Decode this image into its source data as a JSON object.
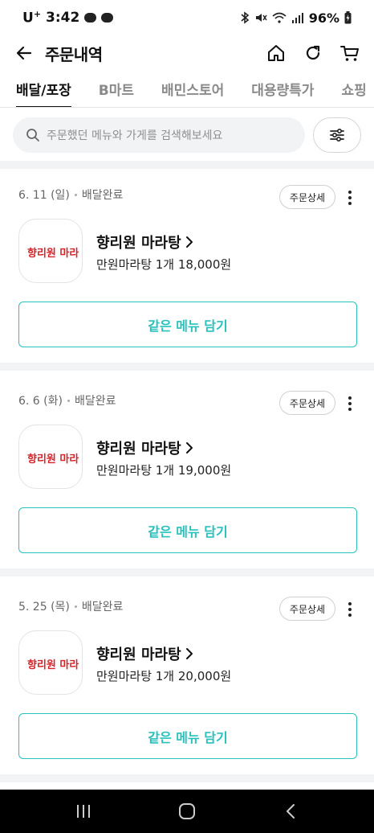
{
  "status_bar": {
    "carrier": "U",
    "carrier_sup": "+",
    "time": "3:42",
    "battery": "96%"
  },
  "header": {
    "title": "주문내역"
  },
  "tabs": [
    {
      "label": "배달/포장",
      "active": true
    },
    {
      "label": "B마트",
      "active": false
    },
    {
      "label": "배민스토어",
      "active": false
    },
    {
      "label": "대용량특가",
      "active": false
    },
    {
      "label": "쇼핑",
      "active": false
    }
  ],
  "search": {
    "placeholder": "주문했던 메뉴와 가게를 검색해보세요"
  },
  "orders": [
    {
      "date": "6. 11 (일)",
      "status": "배달완료",
      "detail_label": "주문상세",
      "store": "향리원 마라탕",
      "summary": "만원마라탕 1개 18,000원",
      "reorder_label": "같은 메뉴 담기",
      "logo_text": "향리원 마라탕"
    },
    {
      "date": "6. 6 (화)",
      "status": "배달완료",
      "detail_label": "주문상세",
      "store": "향리원 마라탕",
      "summary": "만원마라탕 1개 19,000원",
      "reorder_label": "같은 메뉴 담기",
      "logo_text": "향리원 마라탕"
    },
    {
      "date": "5. 25 (목)",
      "status": "배달완료",
      "detail_label": "주문상세",
      "store": "향리원 마라탕",
      "summary": "만원마라탕 1개 20,000원",
      "reorder_label": "같은 메뉴 담기",
      "logo_text": "향리원 마라탕"
    }
  ],
  "colors": {
    "accent": "#2ac1bc",
    "divider": "#f2f3f5",
    "logo_red": "#d3262a"
  },
  "icons": {
    "back": "arrow-left-icon",
    "home": "home-icon",
    "refresh": "refresh-icon",
    "cart": "cart-icon",
    "search": "search-icon",
    "filter": "filter-sliders-icon",
    "more": "more-vertical-icon"
  }
}
